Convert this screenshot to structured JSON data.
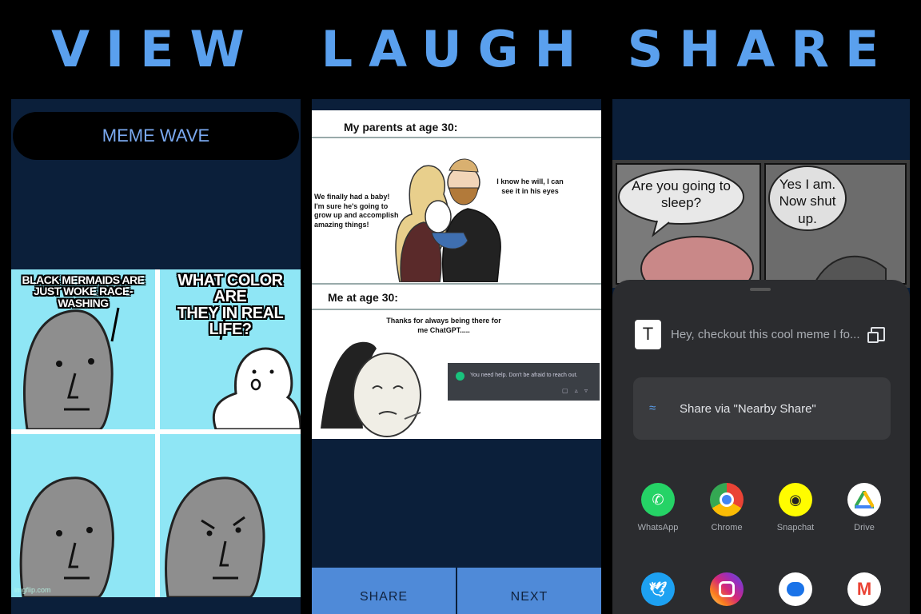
{
  "headings": {
    "view": "VIEW",
    "laugh": "LAUGH",
    "share": "SHARE"
  },
  "panel1": {
    "app_title": "MEME WAVE",
    "meme": {
      "caption_left_1": "BLACK MERMAIDS ARE",
      "caption_left_2": "JUST WOKE RACE-WASHING",
      "caption_right_1": "WHAT COLOR ARE",
      "caption_right_2": "THEY IN REAL LIFE?",
      "watermark": "imgflip.com"
    }
  },
  "panel2": {
    "comic": {
      "top_label": "My parents at age 30:",
      "mom_text": "We finally had a baby! I'm sure he's going to grow up and accomplish amazing things!",
      "dad_text": "I know he will, I can see it in his eyes",
      "bottom_label": "Me at age 30:",
      "thanks_text": "Thanks for always being there for me ChatGPT.....",
      "chat_message": "You need help. Don't be afraid to reach out."
    },
    "buttons": {
      "share": "SHARE",
      "next": "NEXT"
    }
  },
  "panel3": {
    "comic": {
      "bubble_left": "Are you going to sleep?",
      "bubble_right": "Yes I am. Now shut up."
    },
    "share_text": "Hey, checkout this cool meme I fo...",
    "t_icon": "T",
    "nearby_label": "Share via \"Nearby Share\"",
    "apps": [
      {
        "label": "WhatsApp",
        "color": "#25d366",
        "icon": "whatsapp-icon"
      },
      {
        "label": "Chrome",
        "color": "#ffffff",
        "icon": "chrome-icon"
      },
      {
        "label": "Snapchat",
        "color": "#fffc00",
        "icon": "snapchat-icon"
      },
      {
        "label": "Drive",
        "color": "#ffffff",
        "icon": "drive-icon"
      },
      {
        "label": "",
        "color": "#1da1f2",
        "icon": "twitter-icon"
      },
      {
        "label": "",
        "color": "#d6249f",
        "icon": "instagram-icon"
      },
      {
        "label": "",
        "color": "#ffffff",
        "icon": "messages-icon"
      },
      {
        "label": "",
        "color": "#ffffff",
        "icon": "gmail-icon"
      }
    ]
  },
  "colors": {
    "accent": "#5aa0ee",
    "panel_bg": "#0b1f3a",
    "button": "#4f8ad8",
    "sheet": "#2b2c2f"
  }
}
